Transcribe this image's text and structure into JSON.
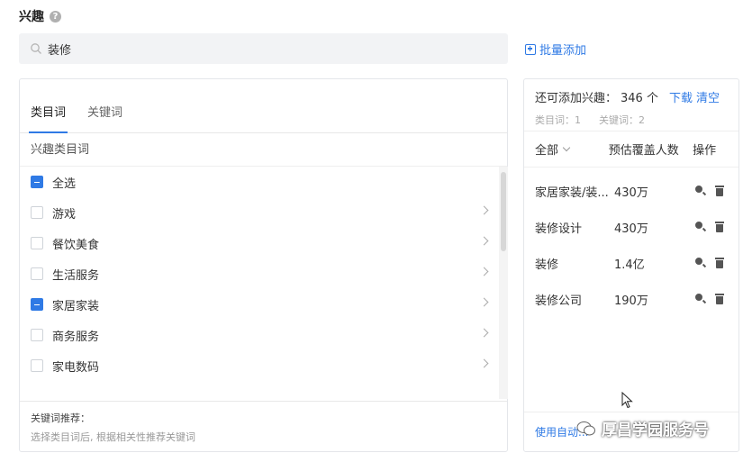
{
  "header": {
    "title": "兴趣",
    "help_icon": "help-circle-icon"
  },
  "search": {
    "value": "装修",
    "placeholder": ""
  },
  "batch_add": {
    "label": "批量添加"
  },
  "tabs": [
    {
      "label": "类目词",
      "active": true
    },
    {
      "label": "关键词",
      "active": false
    }
  ],
  "category": {
    "header": "兴趣类目词",
    "items": [
      {
        "label": "全选",
        "state": "partial",
        "has_children": false
      },
      {
        "label": "游戏",
        "state": "none",
        "has_children": true
      },
      {
        "label": "餐饮美食",
        "state": "none",
        "has_children": true
      },
      {
        "label": "生活服务",
        "state": "none",
        "has_children": true
      },
      {
        "label": "家居家装",
        "state": "partial",
        "has_children": true
      },
      {
        "label": "商务服务",
        "state": "none",
        "has_children": true
      },
      {
        "label": "家电数码",
        "state": "none",
        "has_children": true
      }
    ]
  },
  "recommend": {
    "title": "关键词推荐：",
    "hint": "选择类目词后, 根据相关性推荐关键词"
  },
  "selected": {
    "remaining_label": "还可添加兴趣：",
    "remaining_count": "346 个",
    "download": "下载",
    "clear": "清空",
    "category_count": "类目词：1",
    "keyword_count": "关键词：2",
    "col_all": "全部",
    "col_cover": "预估覆盖人数",
    "col_op": "操作",
    "rows": [
      {
        "name": "家居家装/装...",
        "cover": "430万"
      },
      {
        "name": "装修设计",
        "cover": "430万"
      },
      {
        "name": "装修",
        "cover": "1.4亿"
      },
      {
        "name": "装修公司",
        "cover": "190万"
      }
    ],
    "footer_link": "使用自动..."
  },
  "watermark": {
    "text": "厚昌学园服务号"
  },
  "colors": {
    "accent": "#2f7ae5",
    "border": "#e4e6ea",
    "search_bg": "#f2f3f5"
  }
}
